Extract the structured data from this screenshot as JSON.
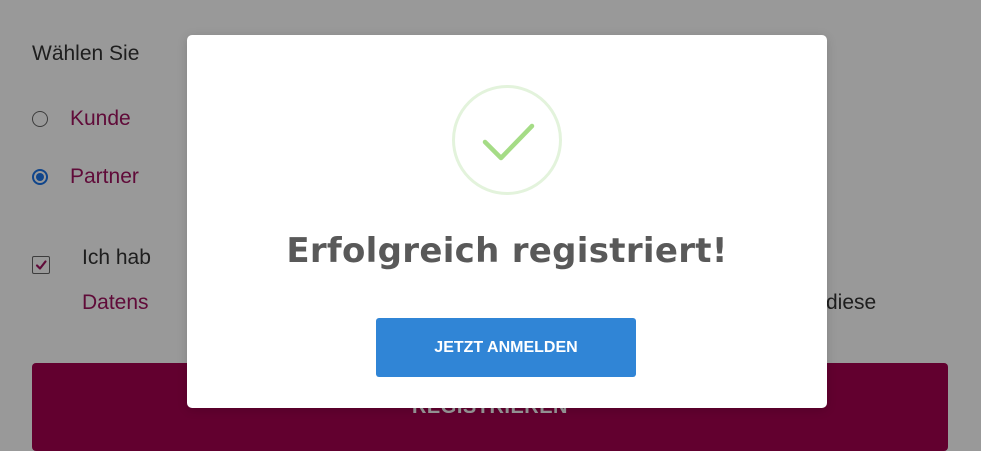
{
  "form": {
    "prompt": "Wählen Sie",
    "options": [
      {
        "label": "Kunde",
        "selected": false
      },
      {
        "label": "Partner",
        "selected": true
      }
    ],
    "consent": {
      "checked": true,
      "line1": "Ich hab",
      "line2": "Datens",
      "tail": "diese"
    },
    "register_label": "REGISTRIEREN"
  },
  "modal": {
    "icon": "success-check-icon",
    "title": "Erfolgreich registriert!",
    "button_label": "JETZT ANMELDEN"
  },
  "colors": {
    "accent": "#a3004f",
    "link_text": "#a0135f",
    "primary_button": "#3085d6",
    "success": "#a5dc86"
  }
}
